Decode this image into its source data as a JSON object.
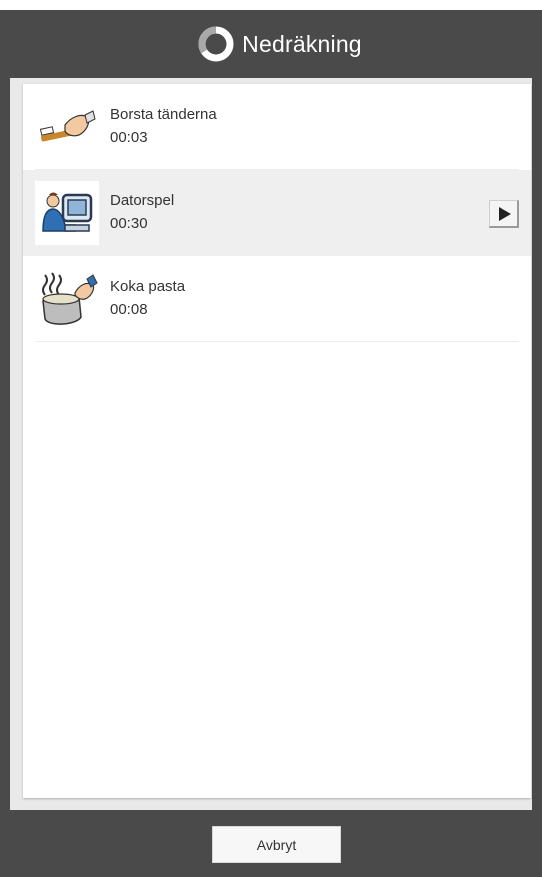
{
  "header": {
    "title": "Nedräkning",
    "icon": "timer-ring-icon"
  },
  "list": {
    "items": [
      {
        "name": "Borsta tänderna",
        "time": "00:03",
        "icon": "toothbrush-icon",
        "selected": false
      },
      {
        "name": "Datorspel",
        "time": "00:30",
        "icon": "computer-game-icon",
        "selected": true
      },
      {
        "name": "Koka pasta",
        "time": "00:08",
        "icon": "cooking-pot-icon",
        "selected": false
      }
    ]
  },
  "footer": {
    "cancel_label": "Avbryt"
  },
  "colors": {
    "bar": "#4a4a4a",
    "selected_row": "#efefef",
    "text": "#333333"
  }
}
